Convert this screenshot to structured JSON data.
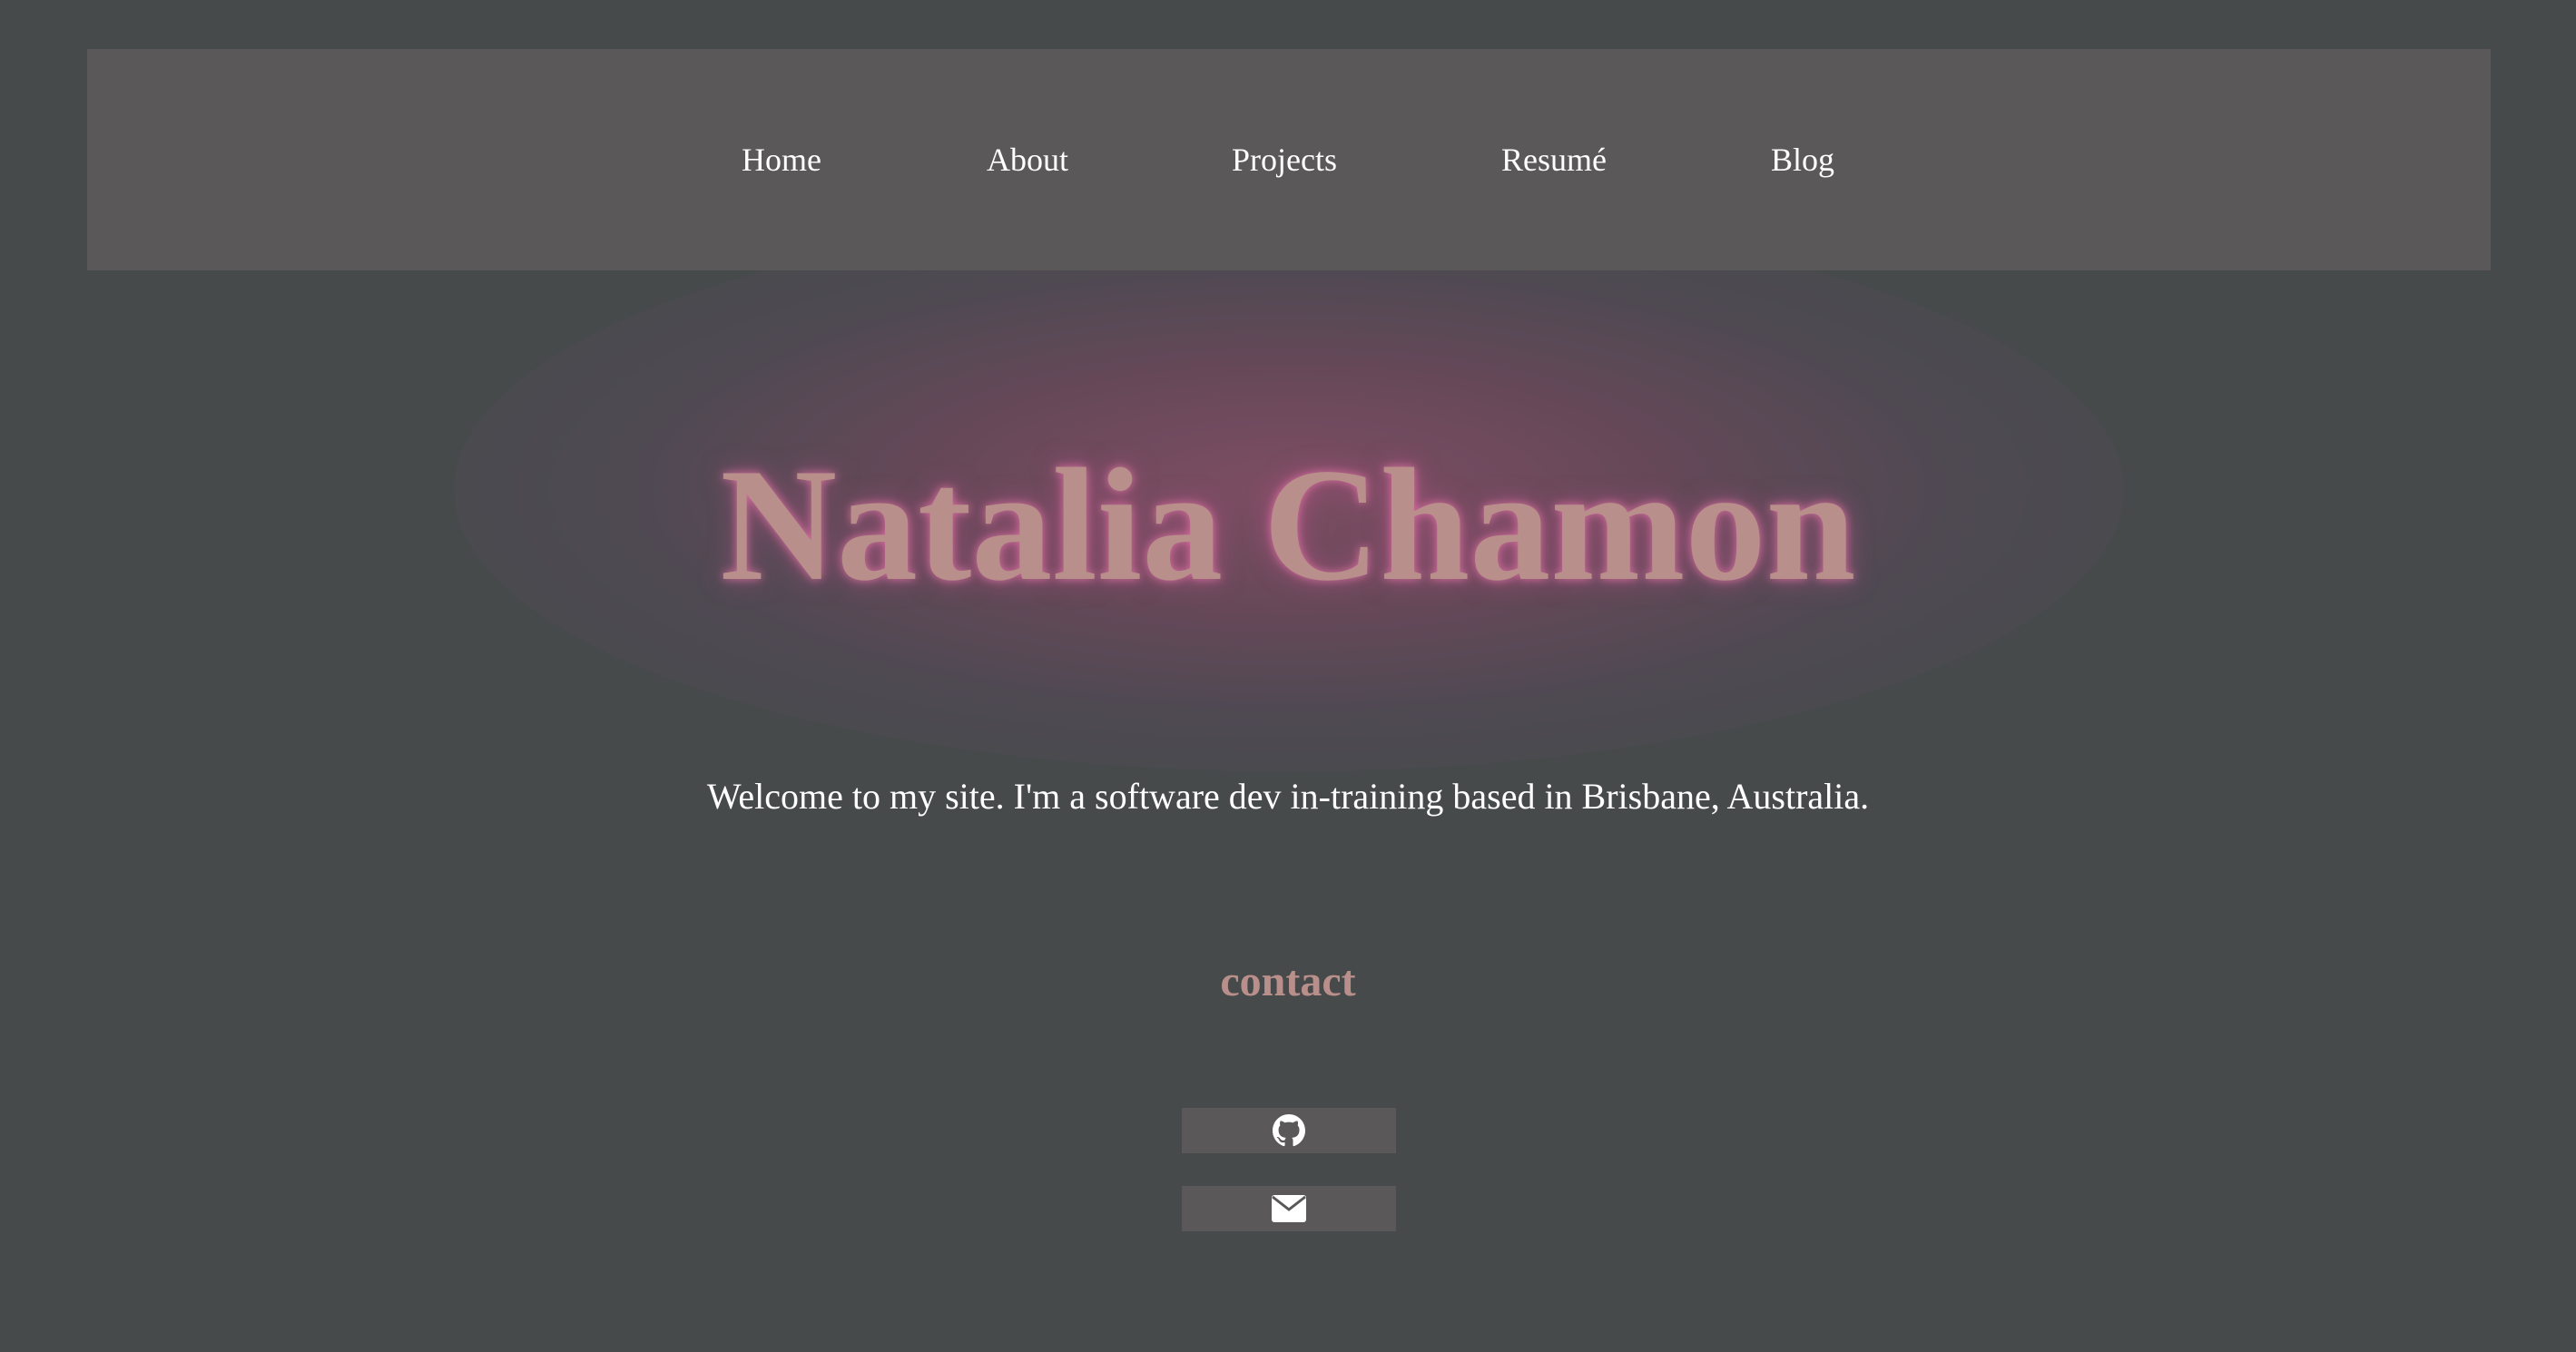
{
  "nav": {
    "items": [
      {
        "label": "Home"
      },
      {
        "label": "About"
      },
      {
        "label": "Projects"
      },
      {
        "label": "Resumé"
      },
      {
        "label": "Blog"
      }
    ]
  },
  "hero": {
    "title": "Natalia Chamon",
    "intro": "Welcome to my site. I'm a software dev in-training based in Brisbane, Australia."
  },
  "contact": {
    "heading": "contact",
    "links": [
      {
        "icon": "github-icon"
      },
      {
        "icon": "envelope-icon"
      }
    ]
  },
  "colors": {
    "background": "#474a4b",
    "navbar": "#5a5858",
    "accent": "#b88f8a",
    "glow": "#aa5078",
    "text": "#ffffff"
  }
}
